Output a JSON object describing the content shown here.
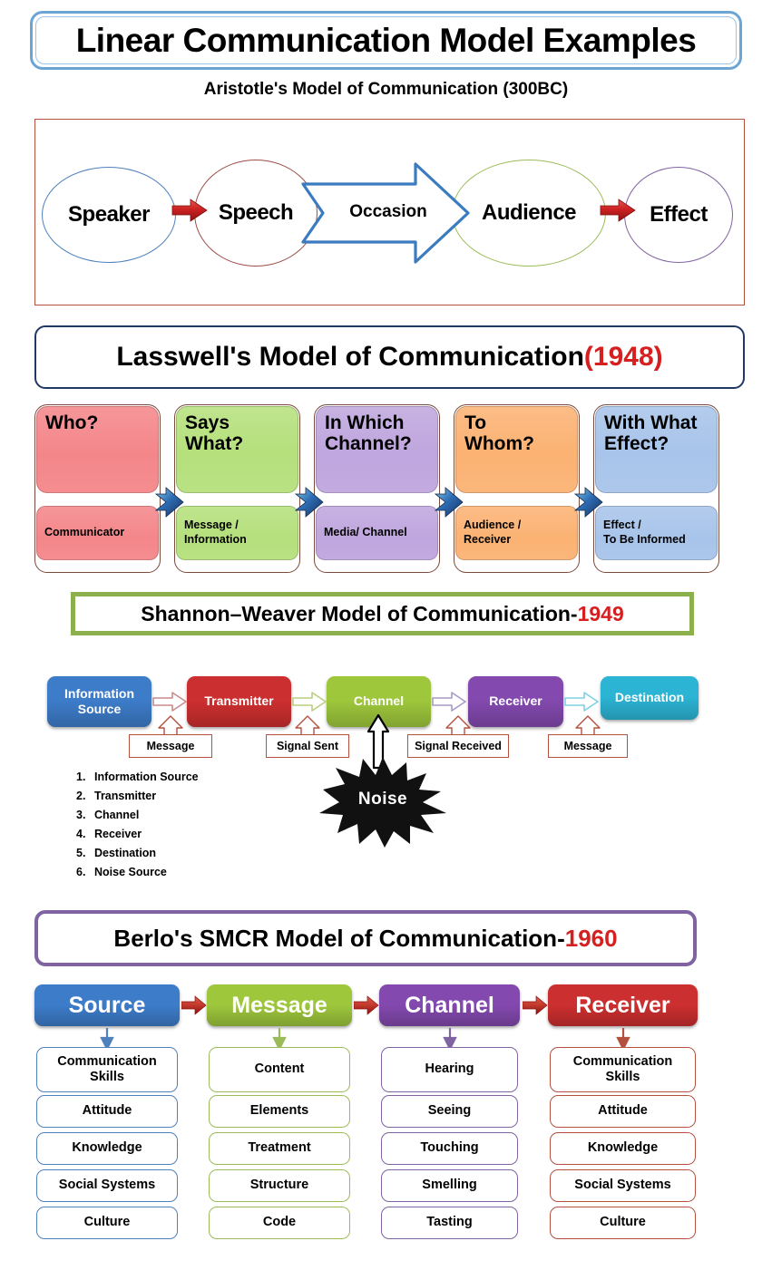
{
  "title": "Linear Communication Model Examples",
  "aristotle": {
    "caption": "Aristotle's Model of Communication (300BC)",
    "nodes": [
      {
        "label": "Speaker",
        "color": "#4f81bd"
      },
      {
        "label": "Speech",
        "color": "#9c4b45"
      },
      {
        "label": "Audience",
        "color": "#9bbb59"
      },
      {
        "label": "Effect",
        "color": "#8064a2"
      }
    ],
    "occasion": "Occasion",
    "frame_color": "#b5503f"
  },
  "lasswell": {
    "banner_title": "Lasswell's Model of Communication ",
    "banner_year": "(1948)",
    "cards": [
      {
        "question": "Who?",
        "answer": "Communicator",
        "top_color": "#f4868a",
        "bottom_color": "#f4868a"
      },
      {
        "question": "Says\nWhat?",
        "answer": "Message /\nInformation",
        "top_color": "#b5e07c",
        "bottom_color": "#b5e07c"
      },
      {
        "question": "In Which\nChannel?",
        "answer": "Media/ Channel",
        "top_color": "#bfa6de",
        "bottom_color": "#bfa6de"
      },
      {
        "question": "To\nWhom?",
        "answer": "Audience /\nReceiver",
        "top_color": "#fbb273",
        "bottom_color": "#fbb273"
      },
      {
        "question": "With What\nEffect?",
        "answer": "Effect /\nTo Be Informed",
        "top_color": "#a8c4ea",
        "bottom_color": "#a8c4ea"
      }
    ],
    "arrow_color": "#1f3864"
  },
  "shannon": {
    "banner_title": "Shannon–Weaver Model of Communication-",
    "banner_year": "1949",
    "boxes": [
      {
        "label": "Information\nSource",
        "color": "#3d7cc9"
      },
      {
        "label": "Transmitter",
        "color": "#cc2f2f"
      },
      {
        "label": "Channel",
        "color": "#9ec73c"
      },
      {
        "label": "Receiver",
        "color": "#8349ae"
      },
      {
        "label": "Destination",
        "color": "#2cb4d4"
      }
    ],
    "callouts": [
      "Message",
      "Signal Sent",
      "Signal Received",
      "Message"
    ],
    "noise": "Noise",
    "list": [
      {
        "num": "1.",
        "label": "Information Source"
      },
      {
        "num": "2.",
        "label": "Transmitter"
      },
      {
        "num": "3.",
        "label": "Channel"
      },
      {
        "num": "4.",
        "label": "Receiver"
      },
      {
        "num": "5.",
        "label": "Destination"
      },
      {
        "num": "6.",
        "label": "Noise Source"
      }
    ]
  },
  "berlo": {
    "banner_title": "Berlo's SMCR Model of Communication- ",
    "banner_year": "1960",
    "columns": [
      {
        "header": "Source",
        "color": "#3d7cc9",
        "border": "#4f81bd",
        "items": [
          "Communication\nSkills",
          "Attitude",
          "Knowledge",
          "Social Systems",
          "Culture"
        ]
      },
      {
        "header": "Message",
        "color": "#9ec73c",
        "border": "#9bbb59",
        "items": [
          "Content",
          "Elements",
          "Treatment",
          "Structure",
          "Code"
        ]
      },
      {
        "header": "Channel",
        "color": "#8349ae",
        "border": "#8064a2",
        "items": [
          "Hearing",
          "Seeing",
          "Touching",
          "Smelling",
          "Tasting"
        ]
      },
      {
        "header": "Receiver",
        "color": "#cc2f2f",
        "border": "#b5503f",
        "items": [
          "Communication\nSkills",
          "Attitude",
          "Knowledge",
          "Social Systems",
          "Culture"
        ]
      }
    ],
    "arrow_color": "#c0392b"
  }
}
